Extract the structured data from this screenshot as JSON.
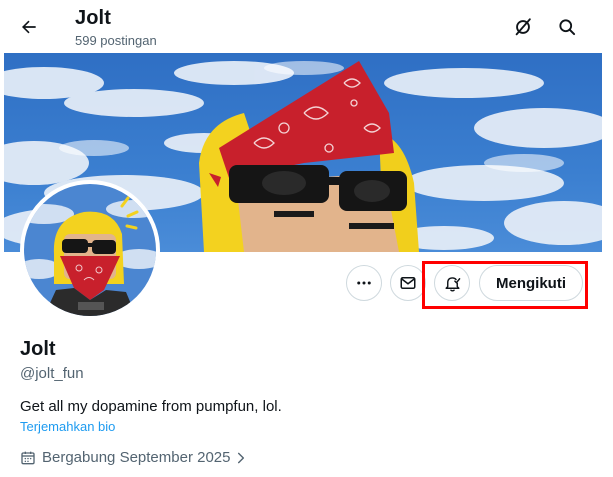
{
  "header": {
    "title": "Jolt",
    "post_count": "599 postingan"
  },
  "actions": {
    "follow_label": "Mengikuti"
  },
  "profile": {
    "name": "Jolt",
    "handle": "@jolt_fun",
    "bio": "Get all my dopamine from pumpfun, lol.",
    "translate_link": "Terjemahkan bio",
    "joined": "Bergabung September 2025"
  },
  "icons": {
    "back": "arrow-left-icon",
    "grok": "grok-slash-icon",
    "search": "search-icon",
    "more": "more-horizontal-icon",
    "message": "envelope-icon",
    "notify": "bell-check-icon",
    "calendar": "calendar-icon",
    "chevron": "chevron-right-icon"
  },
  "colors": {
    "link": "#1d9bf0",
    "secondary_text": "#536471",
    "highlight": "#ff0000"
  }
}
